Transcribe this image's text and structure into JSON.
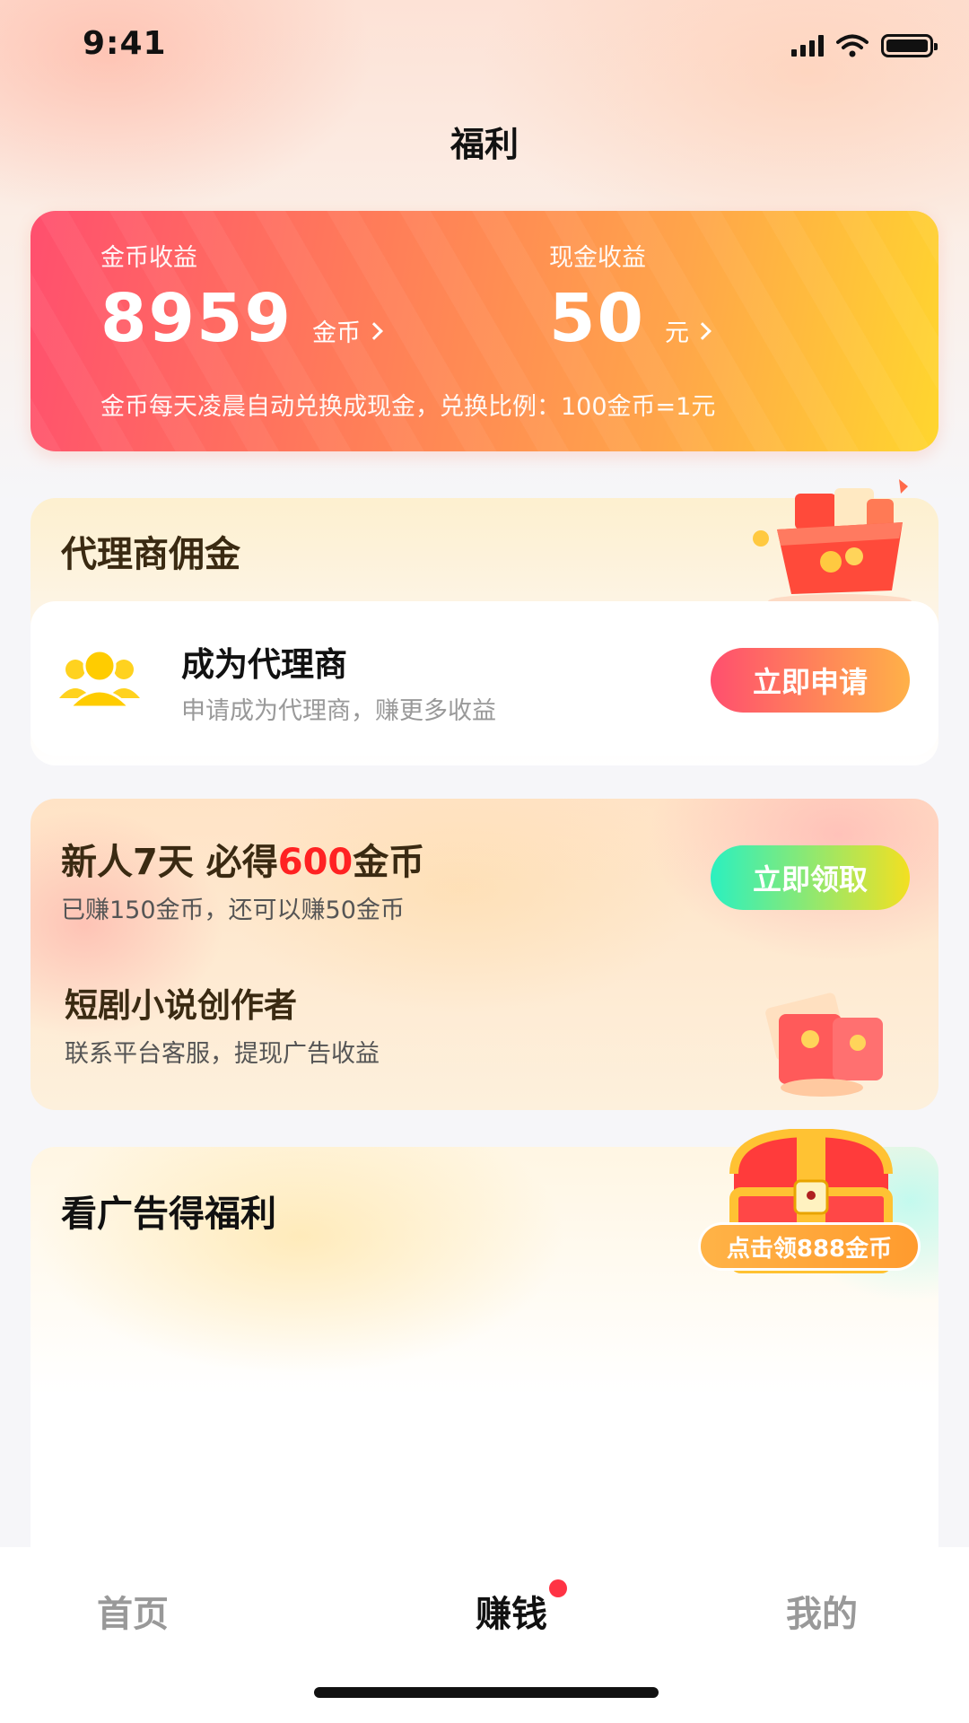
{
  "status_bar": {
    "time": "9:41"
  },
  "page": {
    "title": "福利"
  },
  "earnings": {
    "coin_label": "金币收益",
    "coin_value": "8959",
    "coin_unit": "金币",
    "cash_label": "现金收益",
    "cash_value": "50",
    "cash_unit": "元",
    "note": "金币每天凌晨自动兑换成现金，兑换比例：100金币=1元"
  },
  "agent": {
    "section_title": "代理商佣金",
    "name": "成为代理商",
    "desc": "申请成为代理商，赚更多收益",
    "button": "立即申请"
  },
  "newbie": {
    "title_prefix": "新人7天 必得",
    "title_highlight": "600",
    "title_suffix": "金币",
    "subtitle": "已赚150金币，还可以赚50金币",
    "button": "立即领取",
    "creator_title": "短剧小说创作者",
    "creator_sub": "联系平台客服，提现广告收益"
  },
  "ad": {
    "title": "看广告得福利",
    "chest_label": "点击领888金币"
  },
  "tabbar": {
    "home": "首页",
    "earn": "赚钱",
    "me": "我的"
  },
  "colors": {
    "earn_card_start": "#ff4f6e",
    "earn_card_end": "#ffd62e",
    "highlight_red": "#ff2222",
    "claim_start": "#2bf0c0",
    "claim_end": "#f3e021"
  }
}
